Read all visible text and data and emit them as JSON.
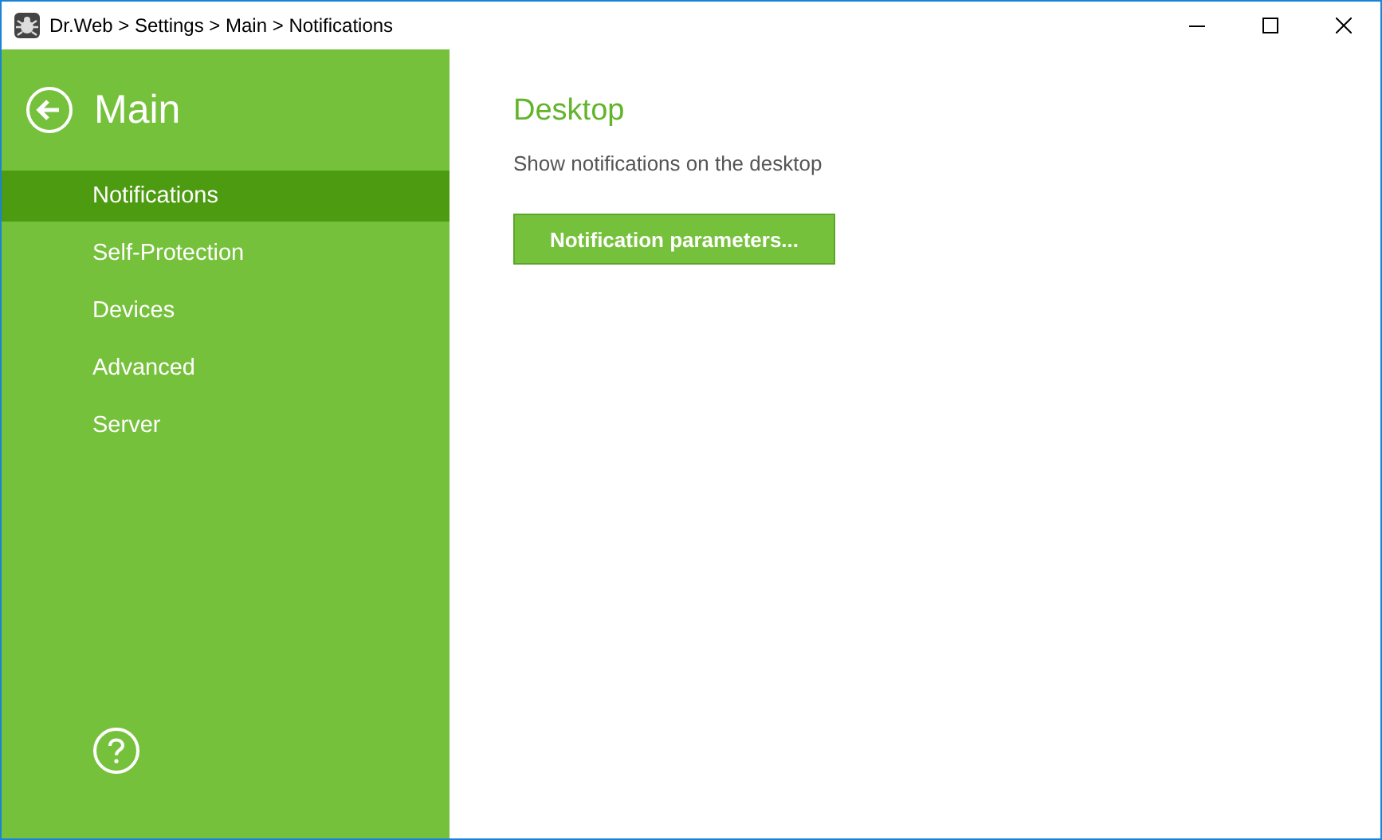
{
  "window": {
    "title": "Dr.Web > Settings > Main > Notifications"
  },
  "sidebar": {
    "title": "Main",
    "items": [
      {
        "label": "Notifications",
        "selected": true
      },
      {
        "label": "Self-Protection",
        "selected": false
      },
      {
        "label": "Devices",
        "selected": false
      },
      {
        "label": "Advanced",
        "selected": false
      },
      {
        "label": "Server",
        "selected": false
      }
    ]
  },
  "content": {
    "heading": "Desktop",
    "description": "Show notifications on the desktop",
    "button": "Notification parameters..."
  }
}
